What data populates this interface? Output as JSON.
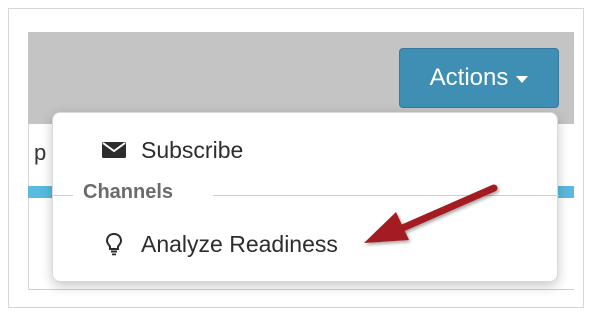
{
  "header": {
    "actions_label": "Actions"
  },
  "background": {
    "partial_text": "p"
  },
  "dropdown": {
    "items": [
      {
        "label": "Subscribe",
        "icon": "envelope-icon"
      },
      {
        "label": "Analyze Readiness",
        "icon": "lightbulb-icon"
      }
    ],
    "section_heading": "Channels"
  },
  "colors": {
    "actions_button": "#3f8fb4",
    "header_bar": "#c4c4c4",
    "accent_strip": "#5ab9de",
    "annotation_arrow": "#a31d22"
  }
}
